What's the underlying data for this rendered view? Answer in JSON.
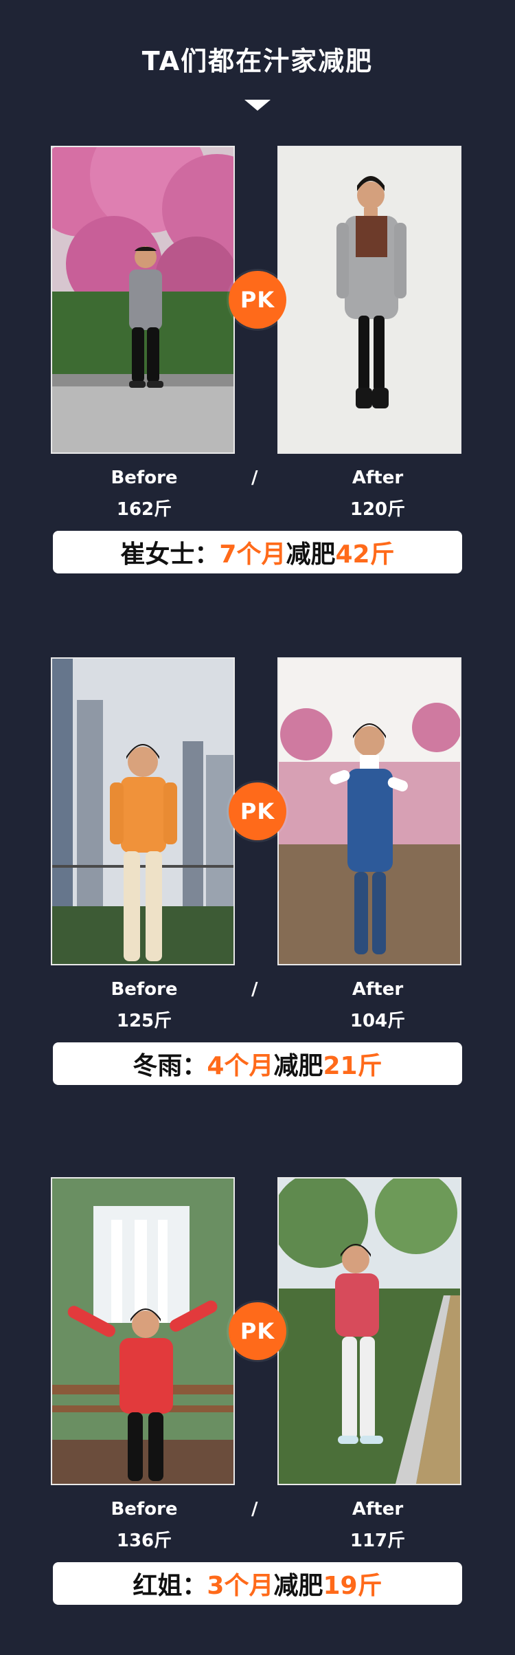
{
  "title": "TA们都在汁家减肥",
  "pk_label": "PK",
  "slash": "/",
  "cases": [
    {
      "before_label": "Before",
      "before_weight": "162斤",
      "after_label": "After",
      "after_weight": "120斤",
      "summary": {
        "name": "崔女士：",
        "duration": "7个月",
        "mid": "减肥",
        "amount": "42斤"
      }
    },
    {
      "before_label": "Before",
      "before_weight": "125斤",
      "after_label": "After",
      "after_weight": "104斤",
      "summary": {
        "name": "冬雨：",
        "duration": "4个月",
        "mid": "减肥",
        "amount": "21斤"
      }
    },
    {
      "before_label": "Before",
      "before_weight": "136斤",
      "after_label": "After",
      "after_weight": "117斤",
      "summary": {
        "name": "红姐：",
        "duration": "3个月",
        "mid": "减肥",
        "amount": "19斤"
      }
    }
  ],
  "colors": {
    "background": "#1f2435",
    "accent": "#ff6a1a",
    "text": "#ffffff"
  },
  "icons": {
    "pointer": "triangle-down-icon",
    "pk": "pk-badge-icon"
  }
}
